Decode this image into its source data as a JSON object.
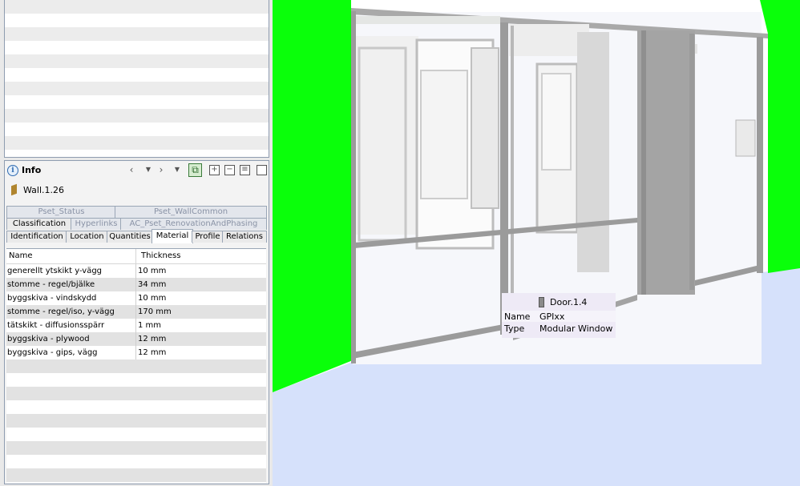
{
  "info_panel": {
    "title": "Info",
    "object_name": "Wall.1.26",
    "toolbar": {
      "back_icon": "chevron-left-icon",
      "forward_icon": "chevron-right-icon",
      "expand_icon": "plus-box-icon",
      "collapse_icon": "minus-box-icon",
      "list_icon": "list-icon",
      "maximize_icon": "maximize-icon"
    },
    "tabs_row1": [
      "Pset_Status",
      "Pset_WallCommon"
    ],
    "tabs_row2": [
      "Classification",
      "Hyperlinks",
      "AC_Pset_RenovationAndPhasing"
    ],
    "tabs_row3": [
      "Identification",
      "Location",
      "Quantities",
      "Material",
      "Profile",
      "Relations"
    ],
    "active_tab": "Material",
    "table": {
      "columns": [
        "Name",
        "Thickness"
      ],
      "rows": [
        {
          "name": "generellt ytskikt y-vägg",
          "thickness": "10 mm"
        },
        {
          "name": "stomme  - regel/bjälke",
          "thickness": "34 mm"
        },
        {
          "name": "byggskiva - vindskydd",
          "thickness": "10 mm"
        },
        {
          "name": "stomme - regel/iso, y-vägg",
          "thickness": "170 mm"
        },
        {
          "name": "tätskikt - diffusionsspärr",
          "thickness": "1 mm"
        },
        {
          "name": "byggskiva - plywood",
          "thickness": "12 mm"
        },
        {
          "name": "byggskiva - gips, vägg",
          "thickness": "12 mm"
        }
      ]
    }
  },
  "viewport": {
    "tooltip": {
      "title": "Door.1.4",
      "rows": [
        {
          "key": "Name",
          "value": "GPIxx"
        },
        {
          "key": "Type",
          "value": "Modular Window"
        }
      ]
    },
    "colors": {
      "wall_green": "#0aff0a",
      "floor": "#d6e1fb",
      "frame": "#9b9b9b"
    }
  }
}
